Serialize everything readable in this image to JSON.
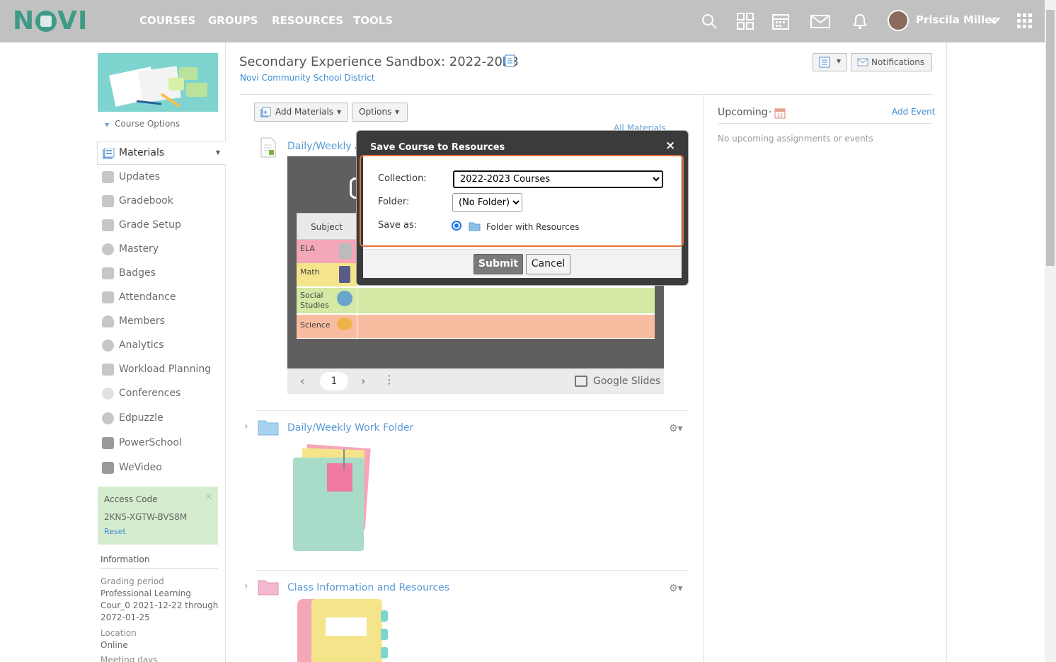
{
  "header": {
    "logo_text": "NOVI",
    "nav": [
      "COURSES",
      "GROUPS",
      "RESOURCES",
      "TOOLS"
    ],
    "user_name": "Priscila Miller",
    "icons": [
      "search-icon",
      "apps-grid-icon",
      "calendar-icon",
      "mail-icon",
      "bell-icon",
      "avatar",
      "chevron-down-icon",
      "launcher-grid-icon"
    ]
  },
  "sidebar": {
    "course_options": "Course Options",
    "items": [
      {
        "label": "Materials",
        "icon": "materials-icon"
      },
      {
        "label": "Updates",
        "icon": "updates-icon"
      },
      {
        "label": "Gradebook",
        "icon": "gradebook-icon"
      },
      {
        "label": "Grade Setup",
        "icon": "grade-setup-icon"
      },
      {
        "label": "Mastery",
        "icon": "mastery-icon"
      },
      {
        "label": "Badges",
        "icon": "badges-icon"
      },
      {
        "label": "Attendance",
        "icon": "attendance-icon"
      },
      {
        "label": "Members",
        "icon": "members-icon"
      },
      {
        "label": "Analytics",
        "icon": "analytics-icon"
      },
      {
        "label": "Workload Planning",
        "icon": "workload-icon"
      },
      {
        "label": "Conferences",
        "icon": "conferences-icon"
      },
      {
        "label": "Edpuzzle",
        "icon": "edpuzzle-icon"
      },
      {
        "label": "PowerSchool",
        "icon": "powerschool-icon"
      },
      {
        "label": "WeVideo",
        "icon": "wevideo-icon"
      }
    ],
    "access": {
      "title": "Access Code",
      "code": "2KN5-XGTW-BVS8M",
      "reset": "Reset"
    },
    "info": {
      "title": "Information",
      "grading_label": "Grading period",
      "grading_l1": "Professional Learning",
      "grading_l2": "Cour_0 2021-12-22 through",
      "grading_l3": "2072-01-25",
      "location_label": "Location",
      "location_value": "Online",
      "meeting_label": "Meeting days"
    }
  },
  "course": {
    "title": "Secondary Experience Sandbox: 2022-2023",
    "district": "Novi Community School District",
    "notifications": "Notifications"
  },
  "toolbar": {
    "add_materials": "Add Materials",
    "options": "Options",
    "all_materials": "All Materials"
  },
  "materials": {
    "item1_title": "Daily/Weekly Ag",
    "slide": {
      "header": "Subject",
      "rows": [
        "ELA",
        "Math",
        "Social Studies",
        "Science"
      ],
      "colors": [
        "#f4a7b9",
        "#f4e58a",
        "#d3e9a4",
        "#f8bda0"
      ],
      "page": "1",
      "brand": "Google Slides"
    },
    "folder1_title": "Daily/Weekly Work Folder",
    "folder2_title": "Class Information and Resources"
  },
  "upcoming": {
    "title": "Upcoming",
    "add_event": "Add Event",
    "empty": "No upcoming assignments or events"
  },
  "dialog": {
    "title": "Save Course to Resources",
    "collection_label": "Collection:",
    "collection_value": "2022-2023 Courses",
    "folder_label": "Folder:",
    "folder_value": "(No Folder)",
    "save_as_label": "Save as:",
    "save_as_option": "Folder with Resources",
    "submit": "Submit",
    "cancel": "Cancel",
    "close": "×"
  },
  "colors": {
    "link": "#3d8bd0",
    "accent_orange": "#e8703a",
    "header_bg": "#c1c1c1",
    "brand_green": "#3f9a86"
  }
}
